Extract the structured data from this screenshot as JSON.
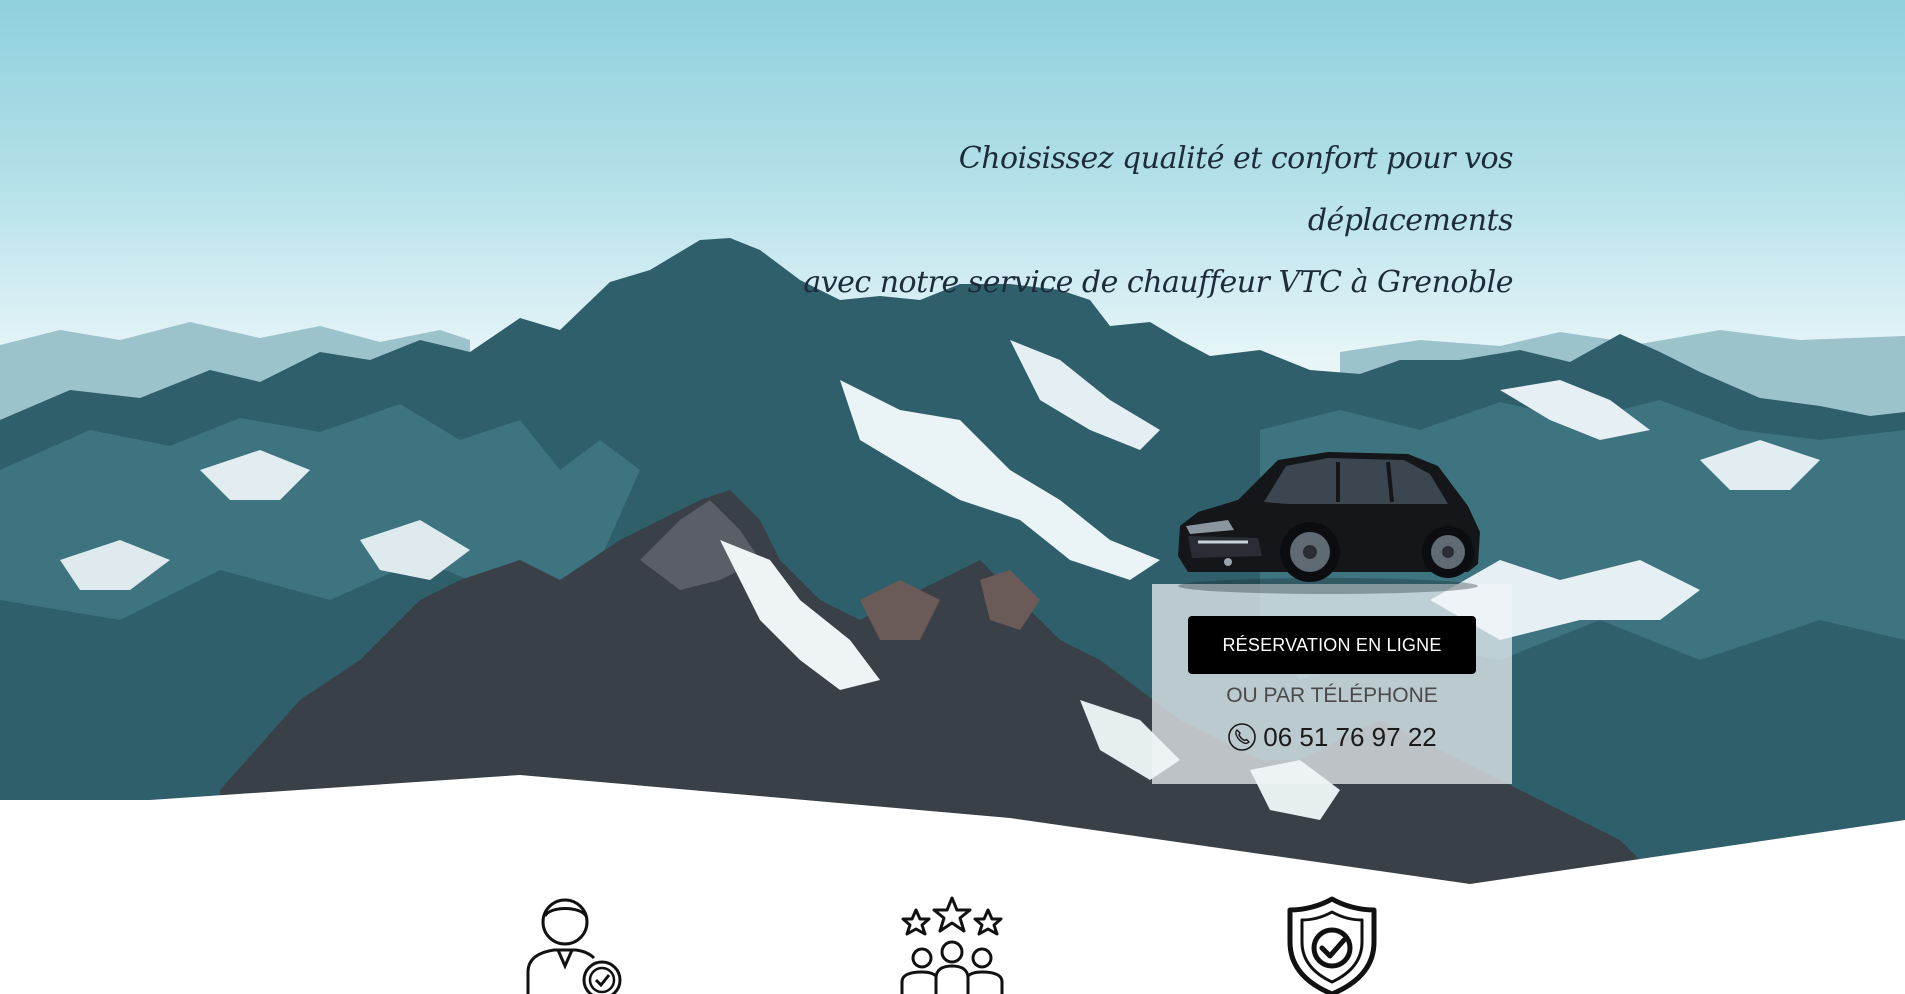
{
  "hero": {
    "tagline_line1": "Choisissez qualité et confort pour vos déplacements",
    "tagline_line2": "avec notre service de chauffeur VTC à Grenoble",
    "reserve_button_label": "RÉSERVATION EN LIGNE",
    "or_phone_label": "OU PAR TÉLÉPHONE",
    "phone_number": "06 51 76 97 22",
    "phone_icon": "phone-icon",
    "car_image": "black-toyota-corolla-estate"
  },
  "features": {
    "icons": [
      "professional-driver-icon",
      "five-star-rating-icon",
      "security-shield-check-icon"
    ]
  },
  "colors": {
    "button_background": "#000000",
    "button_text": "#ffffff",
    "sky": "#b3e0e9",
    "mountain": "#2d5a64"
  }
}
